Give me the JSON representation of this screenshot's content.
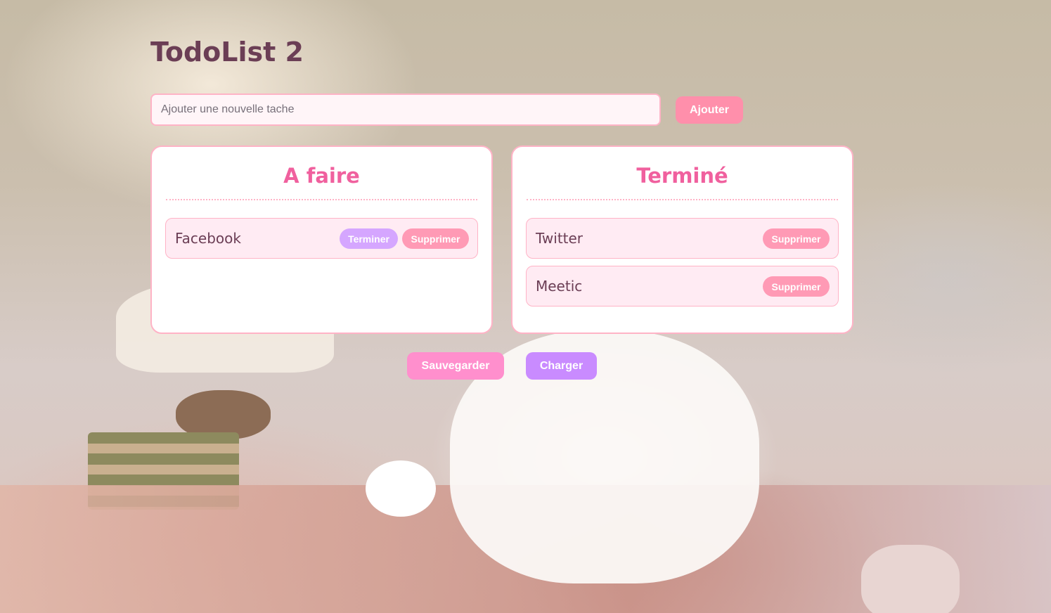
{
  "app": {
    "title": "TodoList 2"
  },
  "new_task": {
    "placeholder": "Ajouter une nouvelle tache",
    "value": "",
    "add_label": "Ajouter"
  },
  "columns": {
    "todo": {
      "title": "A faire",
      "tasks": [
        {
          "label": "Facebook",
          "finish_label": "Terminer",
          "delete_label": "Supprimer"
        }
      ]
    },
    "done": {
      "title": "Terminé",
      "tasks": [
        {
          "label": "Twitter",
          "delete_label": "Supprimer"
        },
        {
          "label": "Meetic",
          "delete_label": "Supprimer"
        }
      ]
    }
  },
  "actions": {
    "save_label": "Sauvegarder",
    "load_label": "Charger"
  },
  "colors": {
    "accent": "#ff8fab",
    "title": "#6b3e55",
    "column_title": "#f0609e",
    "finish": "#d5a6ff",
    "delete": "#ff9ab5",
    "save": "#ff8fcd",
    "load": "#c98bff"
  }
}
